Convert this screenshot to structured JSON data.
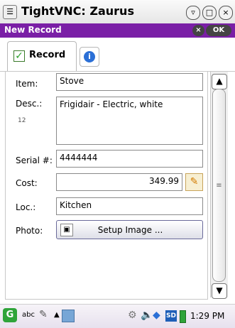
{
  "window": {
    "title": "TightVNC: Zaurus",
    "menu_icon": "menu-icon",
    "buttons": {
      "shade": "▿",
      "maximize": "□",
      "close": "×"
    }
  },
  "app_header": {
    "title": "New Record",
    "close_label": "×",
    "ok_label": "OK"
  },
  "tabs": [
    {
      "label": "Record",
      "icon": "check-icon",
      "selected": true
    },
    {
      "label": "",
      "icon": "info-icon",
      "selected": false
    }
  ],
  "form": {
    "item": {
      "label": "Item:",
      "value": "Stove"
    },
    "desc": {
      "label": "Desc.:",
      "value": "Frigidair - Electric, white"
    },
    "side_mark": "12",
    "serial": {
      "label": "Serial #:",
      "value": "4444444"
    },
    "cost": {
      "label": "Cost:",
      "value": "349.99",
      "edit_icon": "pencil-icon"
    },
    "loc": {
      "label": "Loc.:",
      "value": "Kitchen"
    },
    "photo": {
      "label": "Photo:",
      "button": "Setup Image ..."
    }
  },
  "scrollbar": {
    "up": "▲",
    "down": "▼",
    "grip": "≡"
  },
  "taskbar": {
    "start": "G",
    "input_mode": "abc",
    "pen_icon": "pen-icon",
    "up_arrow": "▲",
    "tray": {
      "settings_icon": "gear-icon",
      "sound_icon": "speaker-icon",
      "network_icon": "network-icon",
      "sd": "SD",
      "battery_icon": "battery-icon"
    },
    "clock": "1:29 PM"
  },
  "colors": {
    "app_header_bg": "#7a1fa6",
    "accent_green": "#2fa43a"
  }
}
